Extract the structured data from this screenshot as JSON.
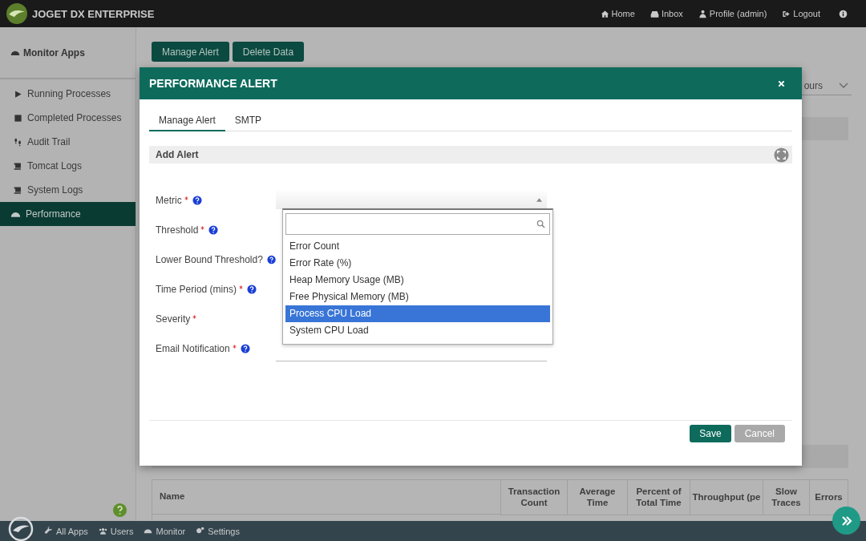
{
  "topbar": {
    "brand": "JOGET DX ENTERPRISE",
    "links": [
      {
        "label": "Home"
      },
      {
        "label": "Inbox"
      },
      {
        "label": "Profile (admin)"
      },
      {
        "label": "Logout"
      }
    ]
  },
  "sidebar": {
    "title": "Monitor Apps",
    "items": [
      {
        "label": "Running Processes",
        "selected": false
      },
      {
        "label": "Completed Processes",
        "selected": false
      },
      {
        "label": "Audit Trail",
        "selected": false
      },
      {
        "label": "Tomcat Logs",
        "selected": false
      },
      {
        "label": "System Logs",
        "selected": false
      },
      {
        "label": "Performance",
        "selected": true
      }
    ]
  },
  "page": {
    "buttons": [
      "Manage Alert",
      "Delete Data"
    ],
    "range_select": "ours",
    "table": {
      "columns": [
        "Name",
        "Transaction Count",
        "Average Time",
        "Percent of Total Time",
        "Throughput (pe",
        "Slow Traces",
        "Errors"
      ]
    }
  },
  "modal": {
    "title": "PERFORMANCE ALERT",
    "tabs": [
      {
        "label": "Manage Alert",
        "selected": true
      },
      {
        "label": "SMTP",
        "selected": false
      }
    ],
    "section": "Add Alert",
    "fields": [
      {
        "label": "Metric",
        "required": true,
        "help": true,
        "kind": "select"
      },
      {
        "label": "Threshold",
        "required": true,
        "help": true,
        "kind": "covered"
      },
      {
        "label": "Lower Bound Threshold?",
        "required": false,
        "help": true,
        "kind": "covered"
      },
      {
        "label": "Time Period (mins)",
        "required": true,
        "help": true,
        "kind": "covered"
      },
      {
        "label": "Severity",
        "required": true,
        "help": false,
        "kind": "covered"
      },
      {
        "label": "Email Notification",
        "required": true,
        "help": true,
        "kind": "line"
      }
    ],
    "metric_options": [
      {
        "label": "Error Count",
        "selected": false
      },
      {
        "label": "Error Rate (%)",
        "selected": false
      },
      {
        "label": "Heap Memory Usage (MB)",
        "selected": false
      },
      {
        "label": "Free Physical Memory (MB)",
        "selected": false
      },
      {
        "label": "Process CPU Load",
        "selected": true
      },
      {
        "label": "System CPU Load",
        "selected": false
      }
    ],
    "buttons": [
      {
        "label": "Save",
        "kind": "primary"
      },
      {
        "label": "Cancel",
        "kind": "disabled"
      }
    ]
  },
  "bottom_bar": {
    "items": [
      {
        "label": "All Apps"
      },
      {
        "label": "Users"
      },
      {
        "label": "Monitor"
      },
      {
        "label": "Settings"
      }
    ]
  }
}
